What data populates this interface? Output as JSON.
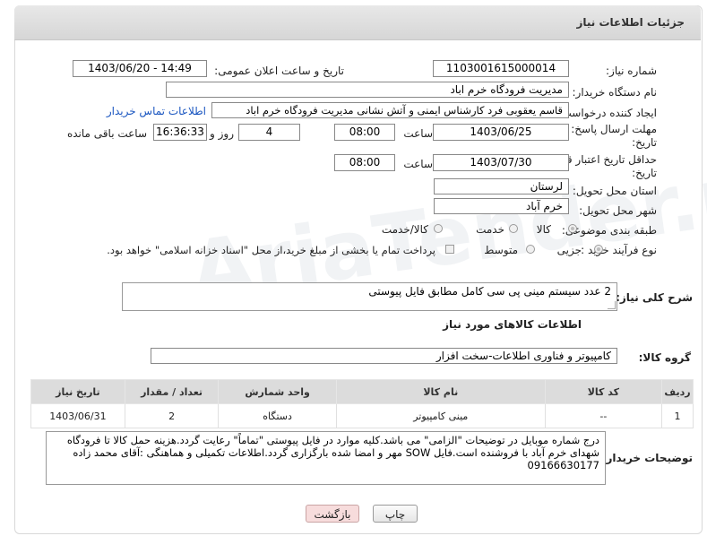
{
  "header": {
    "title": "جزئیات اطلاعات نیاز"
  },
  "fields": {
    "need_number_label": "شماره نیاز:",
    "need_number": "1103001615000014",
    "announce_label": "تاریخ و ساعت اعلان عمومی:",
    "announce_value": "1403/06/20 - 14:49",
    "buyer_org_label": "نام دستگاه خریدار:",
    "buyer_org": "مدیریت فرودگاه خرم اباد",
    "requester_label": "ایجاد کننده درخواست:",
    "requester": "قاسم یعقوبی فرد کارشناس ایمنی و آتش نشانی مدیریت فرودگاه خرم اباد",
    "buyer_contact_link": "اطلاعات تماس خریدار",
    "reply_deadline_label_1": "مهلت ارسال پاسخ: تا",
    "reply_deadline_label_2": "تاریخ:",
    "reply_date": "1403/06/25",
    "time_label": "ساعت",
    "reply_time": "08:00",
    "days_count": "4",
    "days_label": "روز و",
    "remaining_time": "16:36:33",
    "remaining_label": "ساعت باقی مانده",
    "price_validity_label_1": "حداقل تاریخ اعتبار قیمت: تا",
    "price_validity_label_2": "تاریخ:",
    "price_date": "1403/07/30",
    "price_time": "08:00",
    "province_label": "استان محل تحویل:",
    "province": "لرستان",
    "city_label": "شهر محل تحویل:",
    "city": "خرم آباد",
    "category_label": "طبقه بندی موضوعی:",
    "category_options": [
      "کالا",
      "خدمت",
      "کالا/خدمت"
    ],
    "process_label": "نوع فرآیند خرید :",
    "process_options": [
      "جزیی",
      "متوسط"
    ],
    "process_note": "پرداخت تمام یا بخشی از مبلغ خرید،از محل \"اسناد خزانه اسلامی\" خواهد بود."
  },
  "description": {
    "label": "شرح کلی نیاز:",
    "text": "2 عدد سیستم مینی پی سی کامل مطابق فایل پیوستی"
  },
  "goods_section": {
    "title": "اطلاعات کالاهای مورد نیاز",
    "group_label": "گروه کالا:",
    "group_value": "کامپیوتر و فناوری اطلاعات-سخت افزار"
  },
  "table": {
    "headers": [
      "ردیف",
      "کد کالا",
      "نام کالا",
      "واحد شمارش",
      "تعداد / مقدار",
      "تاریخ نیاز"
    ],
    "rows": [
      [
        "1",
        "--",
        "مینی کامپیوتر",
        "دستگاه",
        "2",
        "1403/06/31"
      ]
    ]
  },
  "buyer_notes": {
    "label": "توضیحات خریدار:",
    "line1": "درج شماره موبایل در توضیحات \"الزامی\" می باشد.کلیه موارد در فایل پیوستی  \"تماماً\" رعایت گردد.هزینه حمل کالا تا فرودگاه",
    "line2": "شهدای خرم آباد با فروشنده است.فایل SOW مهر و امضا شده بارگزاری گردد.اطلاعات تکمیلی و هماهنگی :آقای محمد زاده",
    "line3": "09166630177"
  },
  "buttons": {
    "print": "چاپ",
    "back": "بازگشت"
  },
  "watermark": "AriaTender.net",
  "colors": {
    "link": "#1a56c0",
    "header_bg": "#dcdcdc",
    "back_button_bg": "#f6d9d9"
  }
}
